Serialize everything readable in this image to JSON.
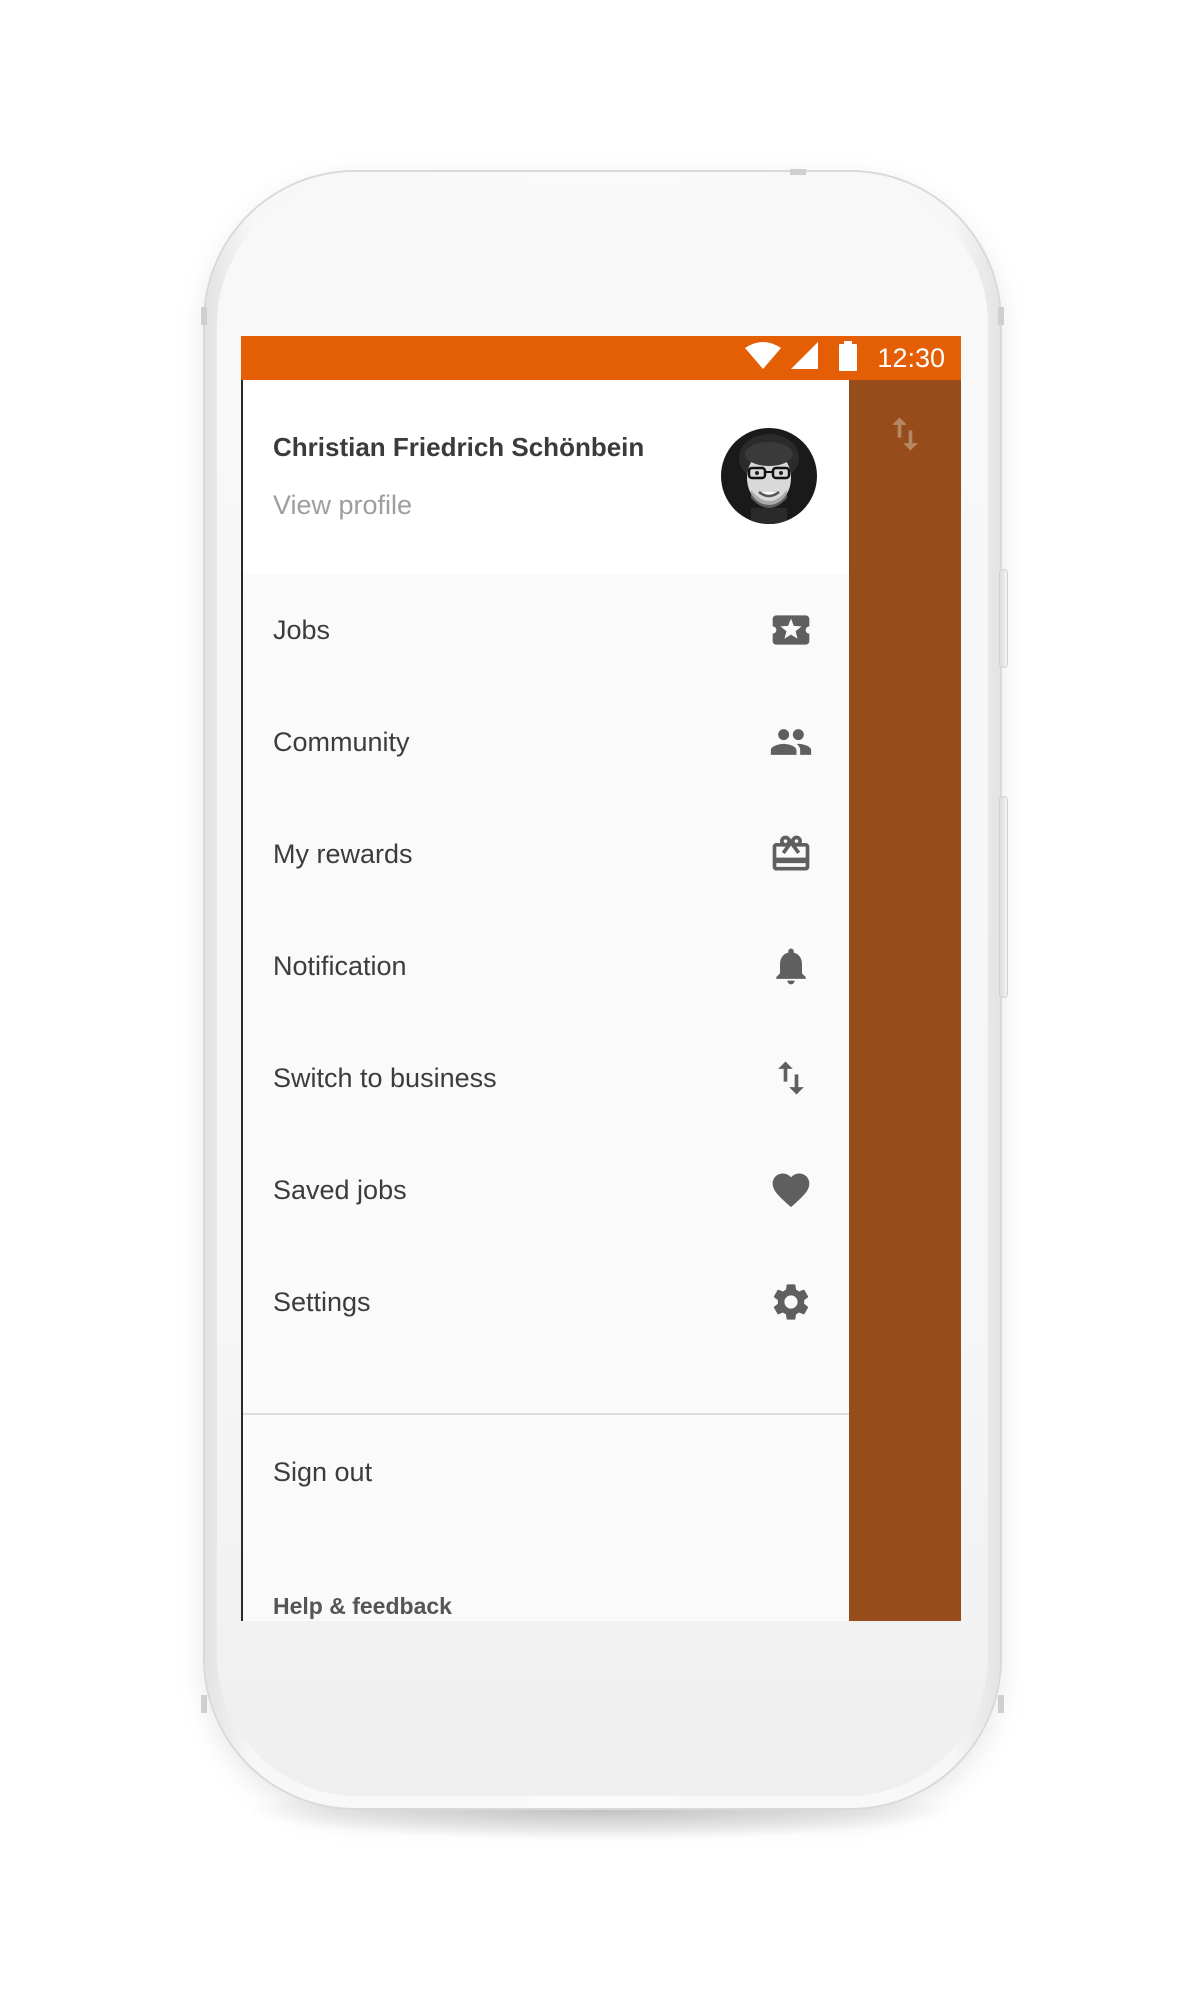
{
  "status_bar": {
    "time": "12:30",
    "icons": [
      "wifi-icon",
      "cellular-signal-icon",
      "battery-icon"
    ],
    "background": "#e35e04"
  },
  "drawer": {
    "header": {
      "user_name": "Christian Friedrich Schönbein",
      "view_profile": "View profile",
      "avatar": "avatar"
    },
    "items": [
      {
        "label": "Jobs",
        "icon": "jobs-ticket-star-icon"
      },
      {
        "label": "Community",
        "icon": "people-icon"
      },
      {
        "label": "My rewards",
        "icon": "gift-card-icon"
      },
      {
        "label": "Notification",
        "icon": "bell-icon"
      },
      {
        "label": "Switch to business",
        "icon": "swap-arrows-icon"
      },
      {
        "label": "Saved jobs",
        "icon": "heart-icon"
      },
      {
        "label": "Settings",
        "icon": "gear-icon"
      }
    ],
    "sign_out": "Sign out",
    "help_feedback": "Help & feedback"
  },
  "scrim": {
    "icon": "swap-arrows-icon",
    "color": "#974c1b"
  },
  "colors": {
    "accent": "#e35e04",
    "icon": "#5f5f5f",
    "text": "#3c3c3c",
    "muted": "#9e9e9e"
  }
}
